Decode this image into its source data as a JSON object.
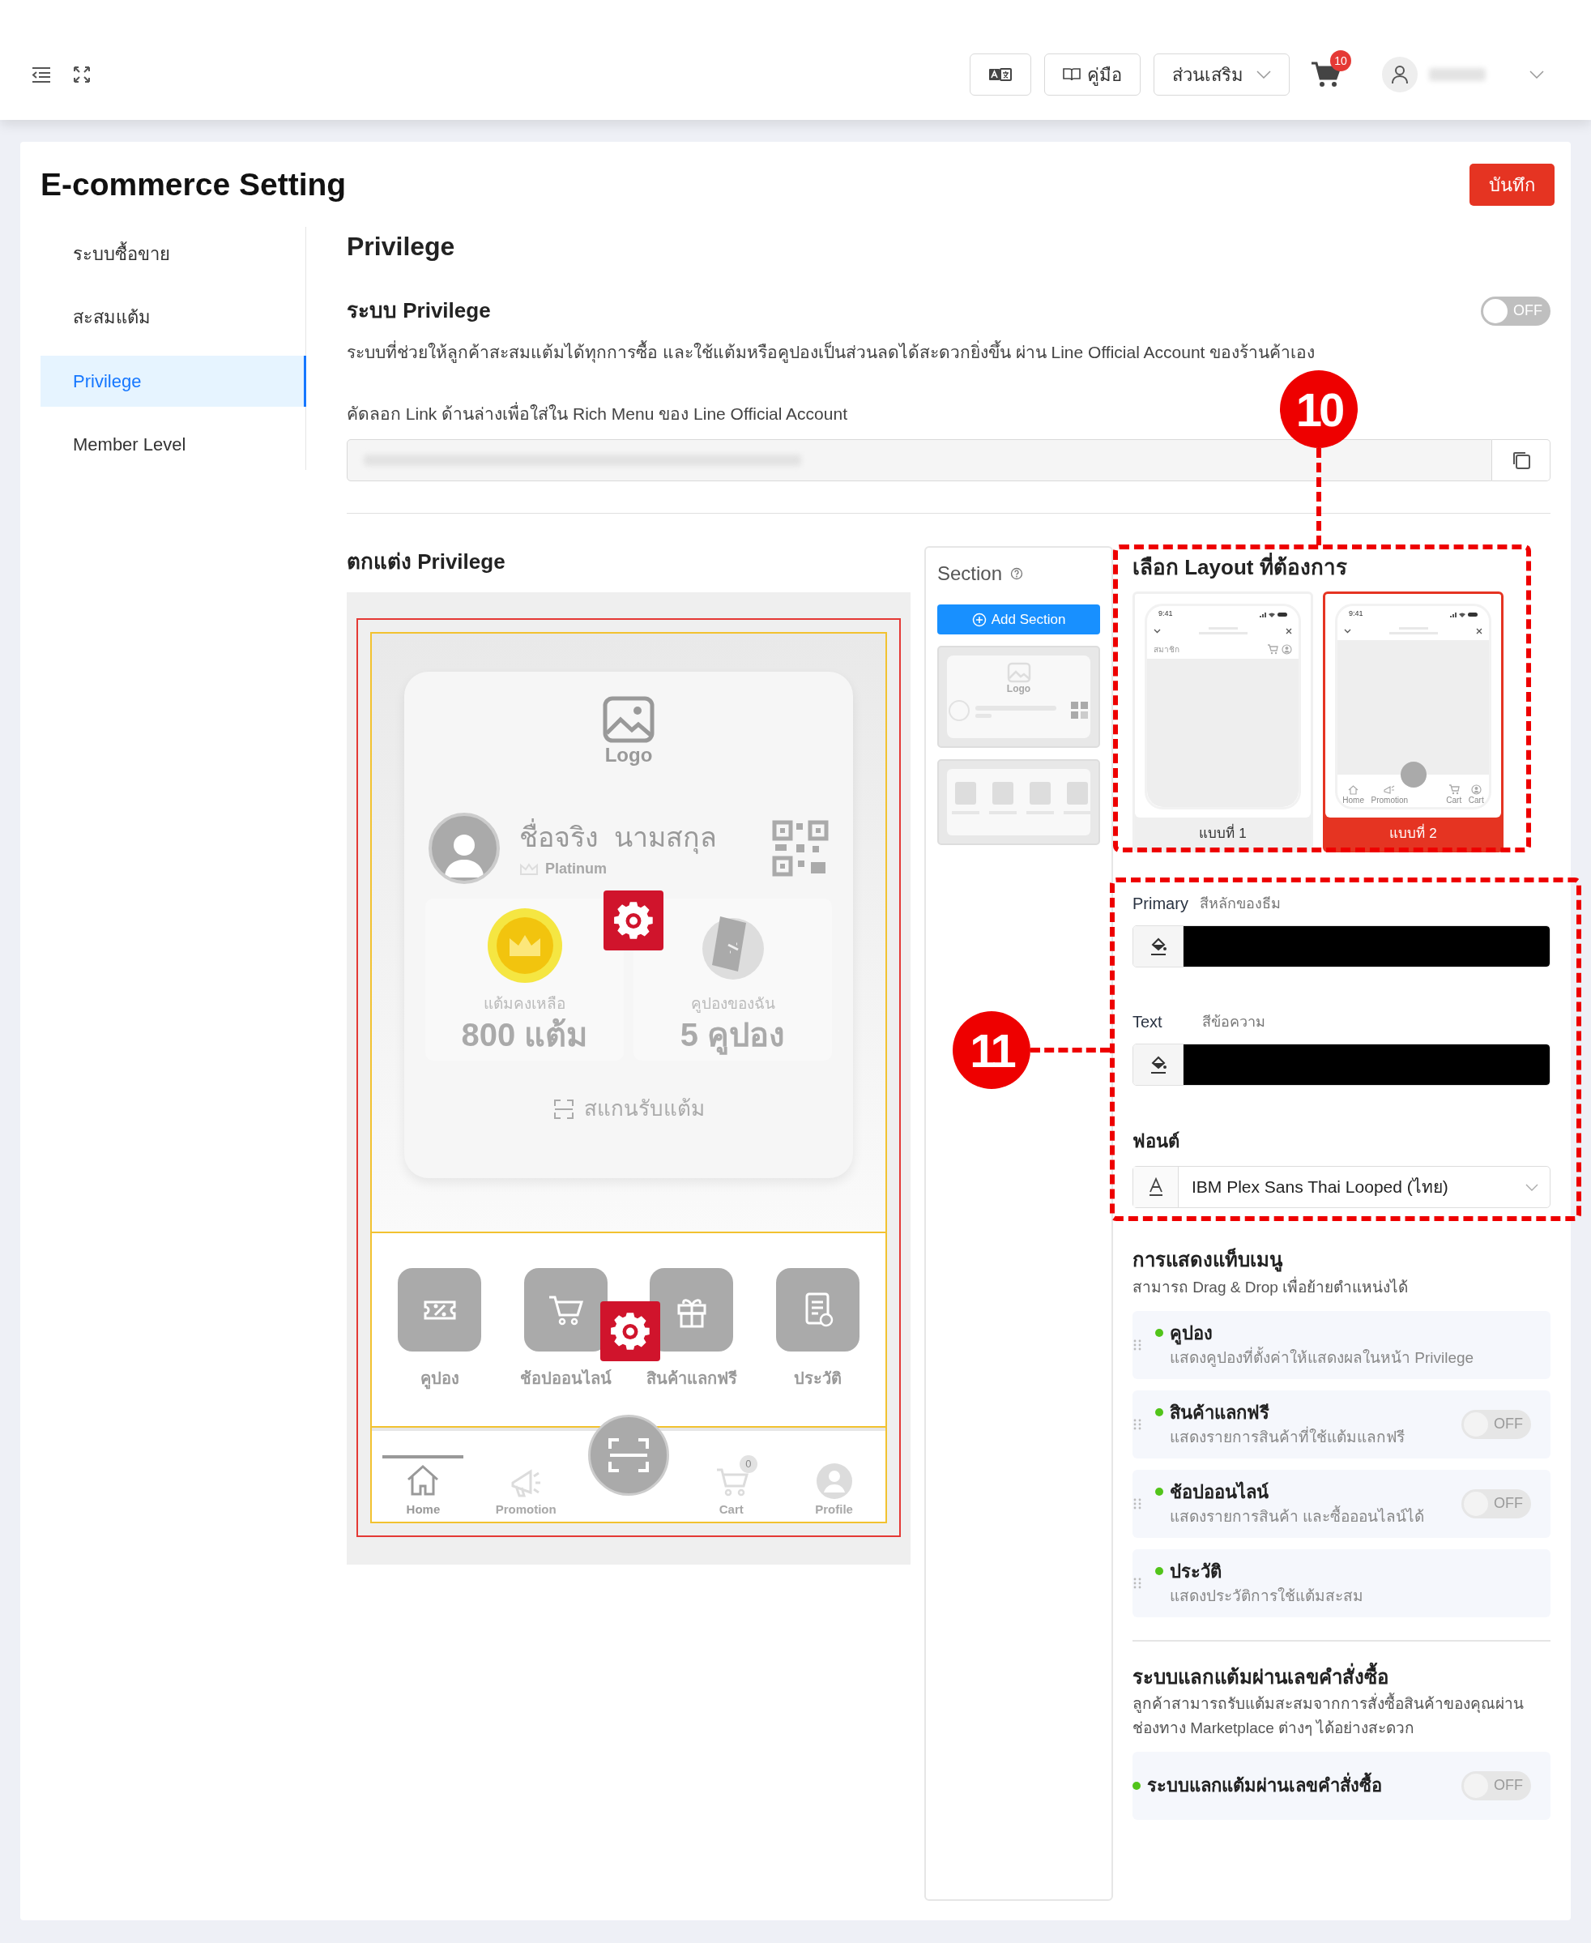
{
  "topbar": {
    "manual": "คู่มือ",
    "addons": "ส่วนเสริม",
    "cart_count": "10"
  },
  "page": {
    "title": "E-commerce Setting",
    "save": "บันทึก"
  },
  "sidebar": [
    {
      "label": "ระบบซื้อขาย",
      "selected": false
    },
    {
      "label": "สะสมแต้ม",
      "selected": false
    },
    {
      "label": "Privilege",
      "selected": true
    },
    {
      "label": "Member Level",
      "selected": false
    }
  ],
  "privilege": {
    "heading": "Privilege",
    "system_title": "ระบบ Privilege",
    "toggle": {
      "on": false,
      "label": "OFF"
    },
    "description": "ระบบที่ช่วยให้ลูกค้าสะสมแต้มได้ทุกการซื้อ และใช้แต้มหรือคูปองเป็นส่วนลดได้สะดวกยิ่งขึ้น ผ่าน Line Official Account ของร้านค้าเอง",
    "link_label": "คัดลอก Link ด้านล่างเพื่อใส่ใน Rich Menu ของ Line Official Account"
  },
  "preview": {
    "heading": "ตกแต่ง Privilege",
    "logo": "Logo",
    "name": "ชื่อจริง  นามสกุล",
    "tier": "Platinum",
    "stats": [
      {
        "kind": "points",
        "caption": "แต้มคงเหลือ",
        "value": "800 แต้ม"
      },
      {
        "kind": "coupons",
        "caption": "คูปองของฉัน",
        "value": "5 คูปอง"
      }
    ],
    "scan": "สแกนรับแต้ม",
    "menu": [
      {
        "kind": "coupon",
        "label": "คูปอง"
      },
      {
        "kind": "shop",
        "label": "ช้อปออนไลน์"
      },
      {
        "kind": "gift",
        "label": "สินค้าแลกฟรี"
      },
      {
        "kind": "history",
        "label": "ประวัติ"
      }
    ],
    "nav": [
      {
        "kind": "home",
        "label": "Home",
        "selected": true
      },
      {
        "kind": "promotion",
        "label": "Promotion",
        "selected": false
      },
      {
        "kind": "scan"
      },
      {
        "kind": "cart",
        "label": "Cart",
        "badge": "0",
        "selected": false
      },
      {
        "kind": "profile",
        "label": "Profile",
        "selected": false
      }
    ]
  },
  "section_panel": {
    "title": "Section",
    "add": "Add Section",
    "thumb_logo": "Logo"
  },
  "layout": {
    "heading": "เลือก Layout ที่ต้องการ",
    "options": [
      {
        "kind": "header",
        "label": "แบบที่ 1",
        "selected": false,
        "time": "9:41",
        "header": "สมาชิก"
      },
      {
        "kind": "bottom_nav",
        "label": "แบบที่ 2",
        "selected": true,
        "time": "9:41",
        "nav": [
          "Home",
          "Promotion",
          "Cart",
          "Cart"
        ]
      }
    ]
  },
  "colors": [
    {
      "label": "Primary",
      "hint": "สีหลักของธีม",
      "color": "#000000"
    },
    {
      "label": "Text",
      "hint": "สีข้อความ",
      "color": "#000000"
    }
  ],
  "font": {
    "label": "ฟอนต์",
    "value": "IBM Plex Sans Thai Looped (ไทย)"
  },
  "tab_menu": {
    "heading": "การแสดงแท็บเมนู",
    "hint": "สามารถ Drag & Drop เพื่อย้ายตำแหน่งได้",
    "items": [
      {
        "title": "คูปอง",
        "description": "แสดงคูปองที่ตั้งค่าให้แสดงผลในหน้า Privilege"
      },
      {
        "title": "สินค้าแลกฟรี",
        "description": "แสดงรายการสินค้าที่ใช้แต้มแลกฟรี",
        "toggle": {
          "on": false,
          "label": "OFF"
        }
      },
      {
        "title": "ช้อปออนไลน์",
        "description": "แสดงรายการสินค้า และซื้อออนไลน์ได้",
        "toggle": {
          "on": false,
          "label": "OFF"
        }
      },
      {
        "title": "ประวัติ",
        "description": "แสดงประวัติการใช้แต้มสะสม"
      }
    ]
  },
  "order_points": {
    "heading": "ระบบแลกแต้มผ่านเลขคำสั่งซื้อ",
    "description": "ลูกค้าสามารถรับแต้มสะสมจากการสั่งซื้อสินค้าของคุณผ่าน ช่องทาง Marketplace ต่างๆ ได้อย่างสะดวก",
    "item": {
      "title": "ระบบแลกแต้มผ่านเลขคำสั่งซื้อ",
      "toggle": {
        "on": false,
        "label": "OFF"
      }
    }
  },
  "annotations": [
    "10",
    "11"
  ]
}
